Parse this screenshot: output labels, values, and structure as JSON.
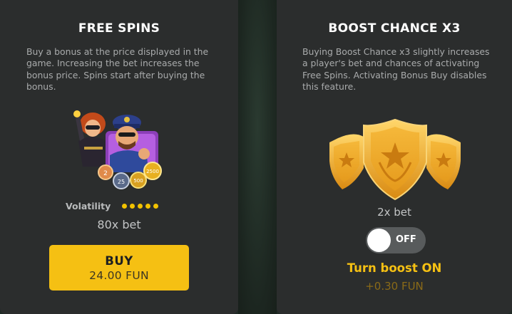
{
  "free_spins": {
    "title": "FREE SPINS",
    "description": "Buy a bonus at the price displayed in the game. Increasing the bet increases the bonus price. Spins start after buying the bonus.",
    "volatility_label": "Volatility",
    "volatility_level": 5,
    "volatility_max": 5,
    "price_multiplier": "80x bet",
    "buy_label": "BUY",
    "buy_price": "24.00 FUN",
    "coin_values": [
      "2",
      "25",
      "500",
      "2500"
    ]
  },
  "boost_chance": {
    "title": "BOOST CHANCE X3",
    "description": "Buying Boost Chance x3 slightly increases a player's bet and chances of activating Free Spins. Activating Bonus Buy disables this feature.",
    "bet_multiplier": "2x bet",
    "toggle_state": "OFF",
    "turn_label": "Turn boost ON",
    "cost": "+0.30 FUN"
  },
  "colors": {
    "accent": "#f5c013",
    "panel": "#2b2d2d",
    "cost_text": "#8a6a18"
  }
}
